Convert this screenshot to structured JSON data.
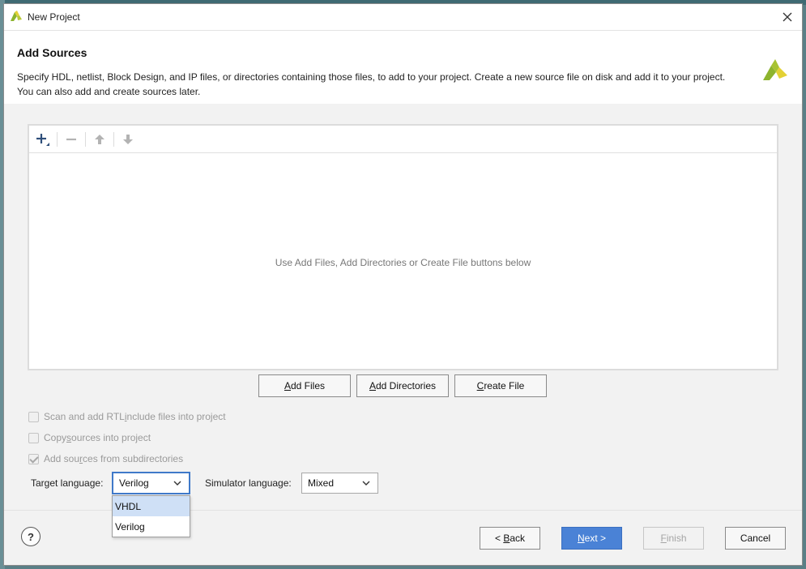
{
  "window": {
    "title": "New Project"
  },
  "header": {
    "title": "Add Sources",
    "description_line1": "Specify HDL, netlist, Block Design, and IP files, or directories containing those files, to add to your project. Create a new source file on disk and add it to your project.",
    "description_line2": "You can also add and create sources later."
  },
  "sources": {
    "empty_message": "Use Add Files, Add Directories or Create File buttons below"
  },
  "actions": {
    "add_files": {
      "mnemonic": "A",
      "rest": "dd Files"
    },
    "add_directories": {
      "mnemonic": "A",
      "rest": "dd Directories"
    },
    "create_file": {
      "mnemonic": "C",
      "rest": "reate File"
    }
  },
  "options": {
    "scan_rtl": {
      "pre": "Scan and add RTL ",
      "mnemonic": "i",
      "post": "nclude files into project",
      "checked": false
    },
    "copy_sources": {
      "pre": "Copy ",
      "mnemonic": "s",
      "post": "ources into project",
      "checked": false
    },
    "add_subdirs": {
      "pre": "Add sou",
      "mnemonic": "r",
      "post": "ces from subdirectories",
      "checked": true
    }
  },
  "language": {
    "target_label": "Target language:",
    "target_value": "Verilog",
    "simulator_label": "Simulator language:",
    "simulator_value": "Mixed",
    "dropdown_options": [
      "VHDL",
      "Verilog"
    ],
    "highlighted_option": "VHDL"
  },
  "footer": {
    "help": "?",
    "back": {
      "pre": "< ",
      "mnemonic": "B",
      "post": "ack"
    },
    "next": {
      "mnemonic": "N",
      "post": "ext >"
    },
    "finish": {
      "mnemonic": "F",
      "post": "inish"
    },
    "cancel": "Cancel"
  },
  "colors": {
    "primary_button": "#4a82d6",
    "logo_green": "#8db42e",
    "logo_yellow": "#e3d135",
    "dropdown_highlight": "#cfe0f6"
  },
  "icons": {
    "title": "vivado-logo-icon",
    "header": "vivado-logo-icon",
    "toolbar": [
      "add-icon",
      "remove-icon",
      "move-up-icon",
      "move-down-icon"
    ]
  }
}
